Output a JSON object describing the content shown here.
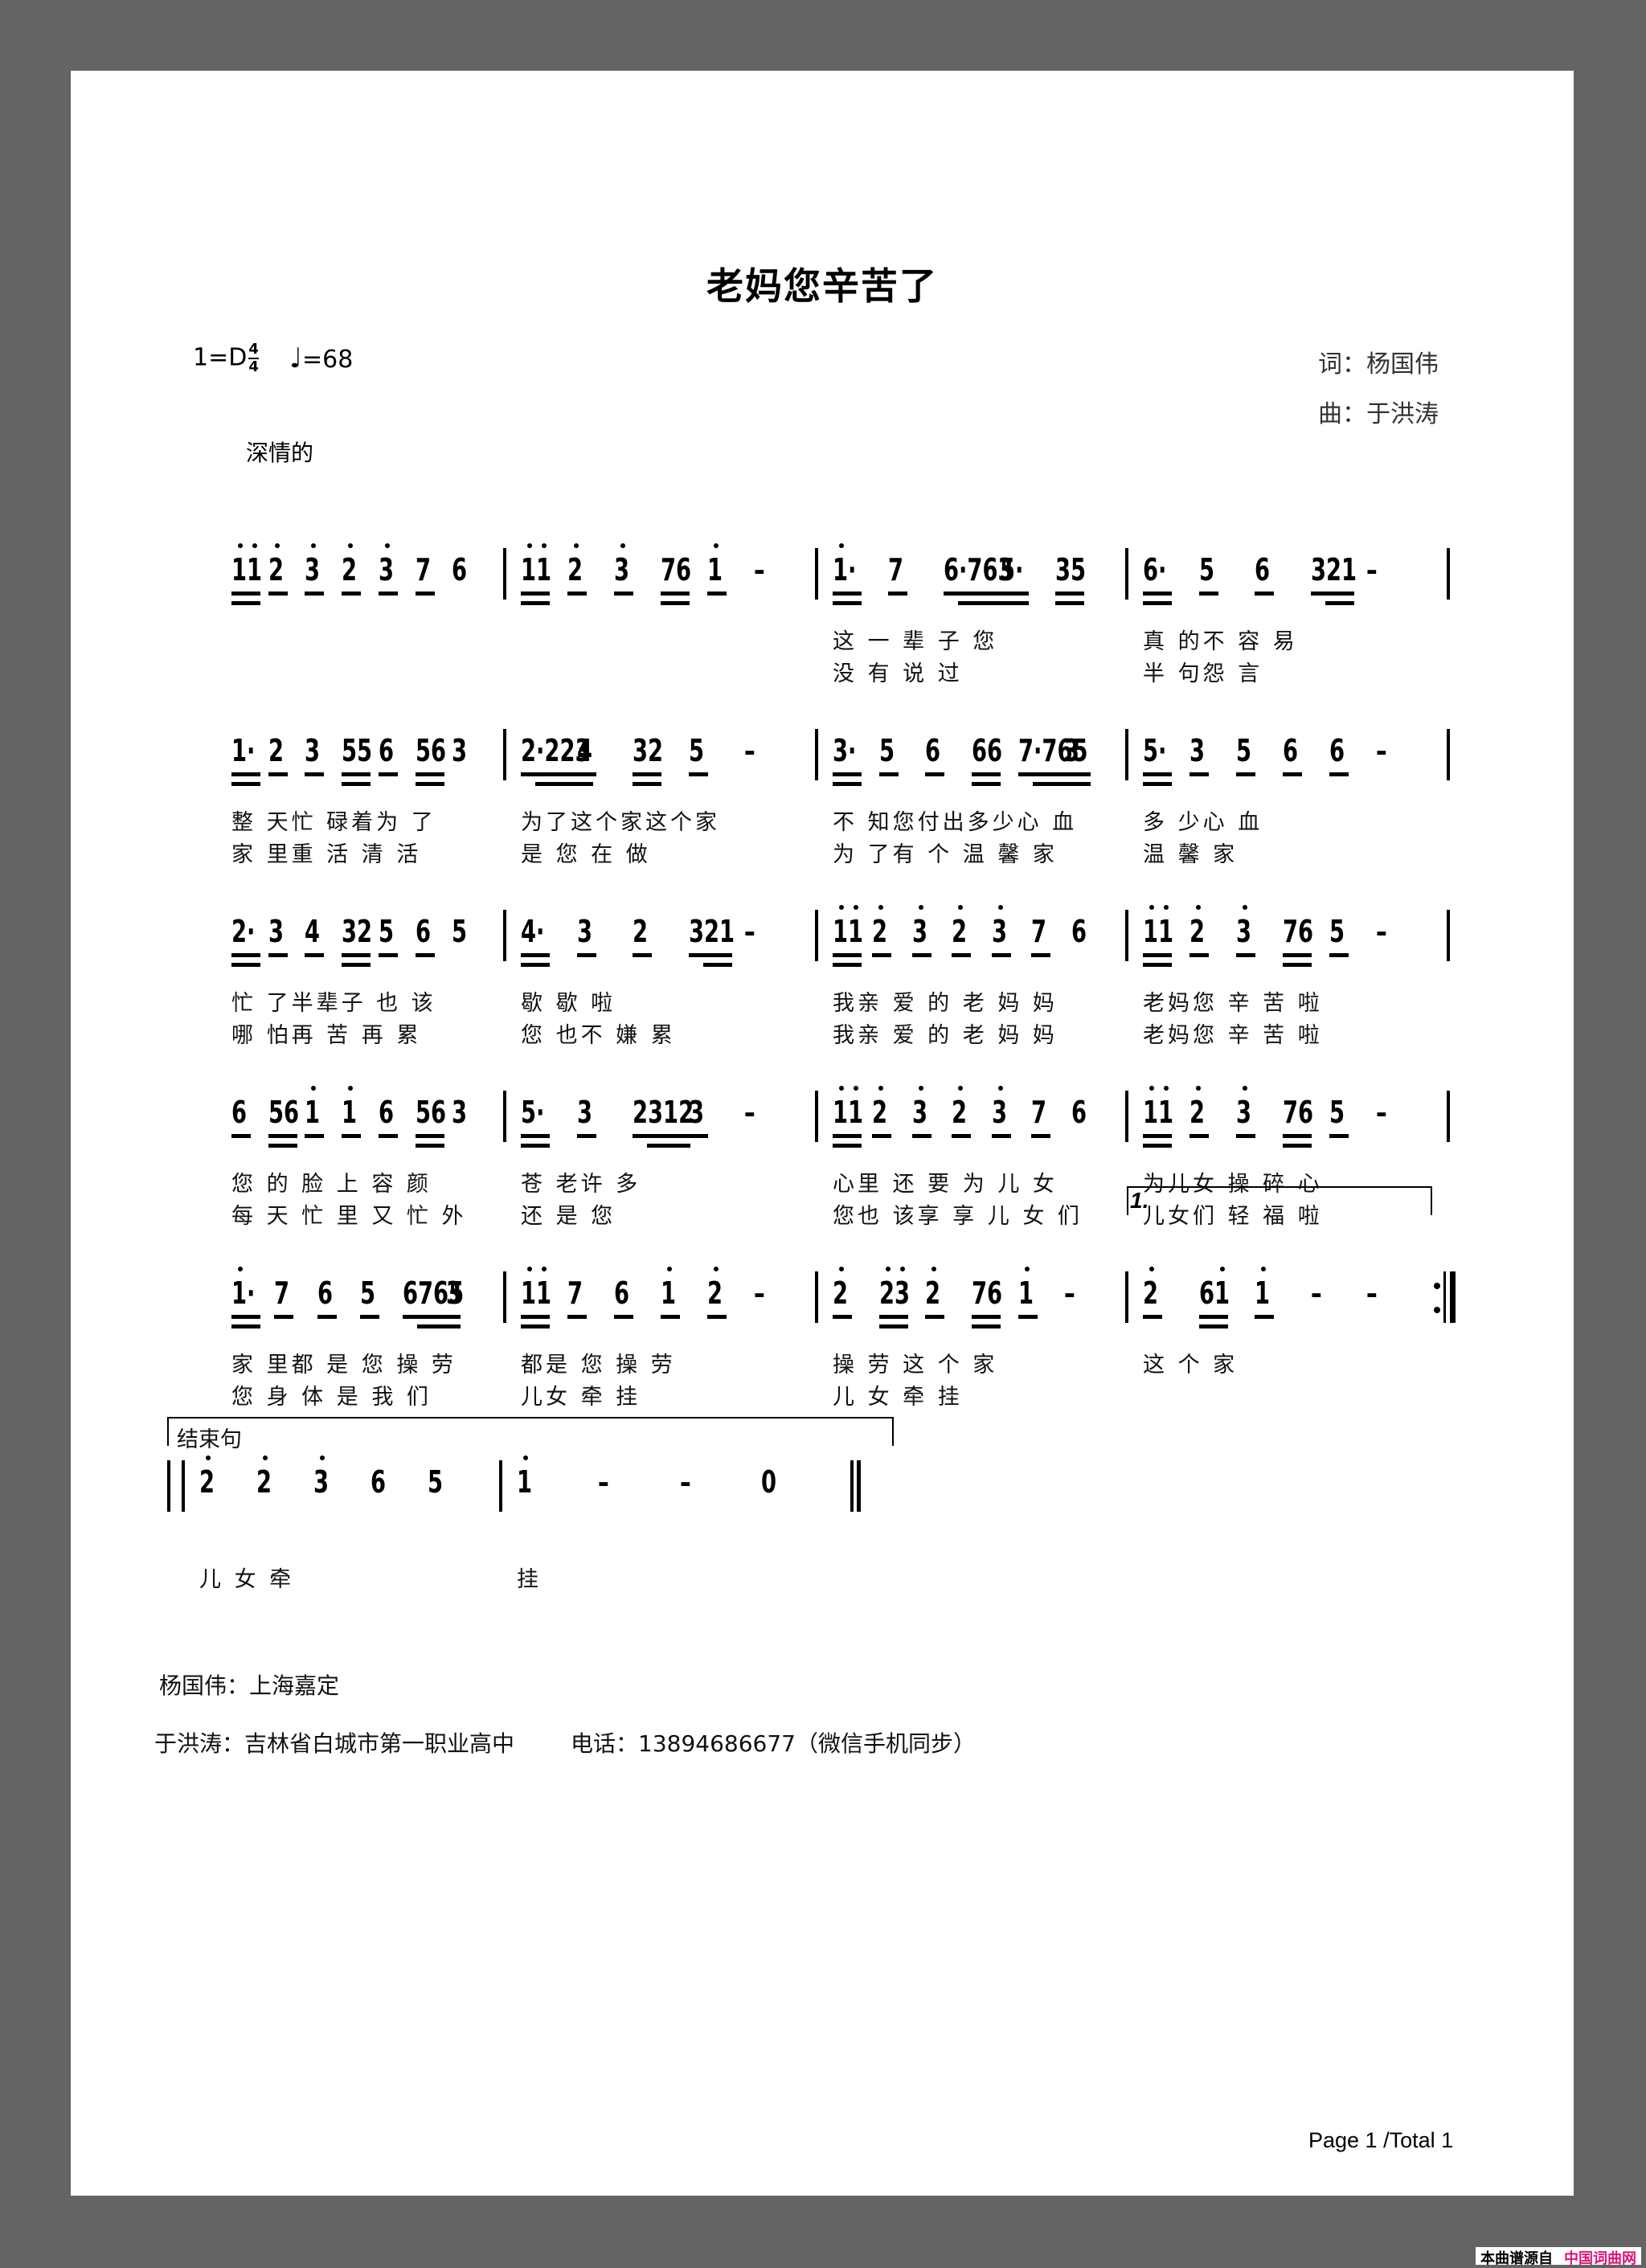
{
  "title": "老妈您辛苦了",
  "key_signature": {
    "prefix": "1=D",
    "time_top": "4",
    "time_bottom": "4"
  },
  "tempo": {
    "note_symbol": "♩",
    "text": "=68"
  },
  "credits": {
    "lyricist": "词：杨国伟",
    "composer": "曲：于洪涛"
  },
  "expression": "深情的",
  "rows": [
    {
      "measures": [
        {
          "notes": [
            "1̇1̇",
            "2̇",
            "3̇",
            "2̇",
            "3̇",
            "7",
            "6"
          ],
          "lyrics1": "",
          "lyrics2": ""
        },
        {
          "notes": [
            "1̇1̇",
            "2̇",
            "3̇",
            "76",
            "1̇",
            "-"
          ],
          "lyrics1": "",
          "lyrics2": ""
        },
        {
          "notes": [
            "1̇·",
            "7",
            "6·763",
            "5·",
            "35"
          ],
          "lyrics1": "这 一 辈 子 您",
          "lyrics2": "没 有 说 过"
        },
        {
          "notes": [
            "6·",
            "5",
            "6",
            "321",
            "-"
          ],
          "lyrics1": "真 的不 容 易",
          "lyrics2": "半 句怨 言"
        }
      ]
    },
    {
      "measures": [
        {
          "notes": [
            "1·",
            "2",
            "3",
            "55",
            "6",
            "56",
            "3"
          ],
          "lyrics1": "整 天忙 碌着为 了",
          "lyrics2": "家 里重 活 清 活"
        },
        {
          "notes": [
            "2·223",
            "4",
            "32",
            "5",
            "-"
          ],
          "lyrics1": "为了这个家这个家",
          "lyrics2": "是 您 在 做"
        },
        {
          "notes": [
            "3·",
            "5",
            "6",
            "66",
            "7·765",
            "3"
          ],
          "lyrics1": "不 知您付出多少心 血",
          "lyrics2": "为 了有 个 温 馨 家"
        },
        {
          "notes": [
            "5·",
            "3",
            "5",
            "6",
            "6",
            "-"
          ],
          "lyrics1": "多 少心 血",
          "lyrics2": "温 馨 家"
        }
      ]
    },
    {
      "measures": [
        {
          "notes": [
            "2·",
            "3",
            "4",
            "32",
            "5",
            "6",
            "5"
          ],
          "lyrics1": "忙 了半辈子 也 该",
          "lyrics2": "哪 怕再 苦 再 累"
        },
        {
          "notes": [
            "4·",
            "3",
            "2",
            "321",
            "-"
          ],
          "lyrics1": "歇 歇 啦",
          "lyrics2": "您 也不 嫌 累"
        },
        {
          "notes": [
            "1̇1̇",
            "2̇",
            "3̇",
            "2̇",
            "3̇",
            "7",
            "6"
          ],
          "lyrics1": "我亲 爱 的 老 妈 妈",
          "lyrics2": "我亲 爱 的 老 妈 妈"
        },
        {
          "notes": [
            "1̇1̇",
            "2̇",
            "3̇",
            "76",
            "5",
            "-"
          ],
          "lyrics1": "老妈您 辛 苦 啦",
          "lyrics2": "老妈您 辛 苦 啦"
        }
      ]
    },
    {
      "measures": [
        {
          "notes": [
            "6",
            "56",
            "1̇",
            "1̇",
            "6",
            "56",
            "3"
          ],
          "lyrics1": "您 的 脸 上 容 颜",
          "lyrics2": "每 天 忙 里 又 忙 外"
        },
        {
          "notes": [
            "5·",
            "3",
            "2312",
            "3",
            "-"
          ],
          "lyrics1": "苍 老许 多",
          "lyrics2": "还 是 您"
        },
        {
          "notes": [
            "1̇1̇",
            "2̇",
            "3̇",
            "2̇",
            "3̇",
            "7",
            "6"
          ],
          "lyrics1": "心里 还 要 为 儿 女",
          "lyrics2": "您也 该享 享 儿 女 们"
        },
        {
          "notes": [
            "1̇1̇",
            "2̇",
            "3̇",
            "76",
            "5",
            "-"
          ],
          "lyrics1": "为儿女 操 碎 心",
          "lyrics2": "儿女们 轻 福 啦"
        }
      ]
    },
    {
      "measures": [
        {
          "notes": [
            "1̇·",
            "7",
            "6",
            "5",
            "6765",
            "3"
          ],
          "lyrics1": "家 里都 是 您 操 劳",
          "lyrics2": "您 身 体 是 我 们"
        },
        {
          "notes": [
            "1̇1̇",
            "7",
            "6",
            "1̇",
            "2̇",
            "-"
          ],
          "lyrics1": "都是 您 操 劳",
          "lyrics2": "儿女 牵 挂"
        },
        {
          "notes": [
            "2̇",
            "2̇3̇",
            "2̇",
            "76",
            "1̇",
            "-"
          ],
          "lyrics1": "操 劳 这 个 家",
          "lyrics2": "儿 女 牵 挂"
        },
        {
          "notes": [
            "2̇",
            "61̇",
            "1̇",
            "-",
            "-"
          ],
          "lyrics1": "这 个 家",
          "lyrics2": "",
          "volta": "1.",
          "end": "repeat"
        }
      ]
    },
    {
      "section_label": "结束句",
      "measures": [
        {
          "notes": [
            "2̇",
            "2̇",
            "3̇",
            "6",
            "5"
          ],
          "lyrics1": "儿 女 牵",
          "lyrics2": ""
        },
        {
          "notes": [
            "1̇",
            "-",
            "-",
            "0"
          ],
          "lyrics1": "挂",
          "lyrics2": "",
          "end": "final"
        }
      ]
    }
  ],
  "footer": {
    "line1": "杨国伟：上海嘉定",
    "line2_name": "于洪涛：吉林省白城市第一职业高中",
    "line2_phone": "电话：13894686677（微信手机同步）"
  },
  "page_indicator": "Page 1 /Total 1",
  "source_badge": {
    "prefix": "本曲谱源自",
    "site": "中国词曲网",
    "site_color": "#e0127a"
  }
}
